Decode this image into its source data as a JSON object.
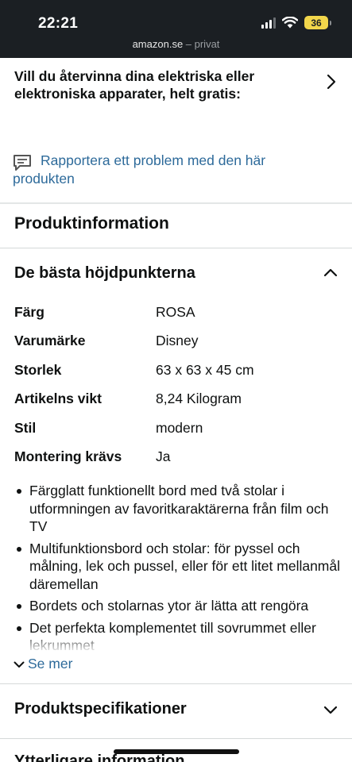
{
  "status_bar": {
    "time": "22:21",
    "battery": "36",
    "url_domain": "amazon.se",
    "url_suffix": " – privat"
  },
  "recycle": {
    "text": "Vill du återvinna dina elektriska eller elektroniska apparater, helt gratis:",
    "icon": "chevron-right-icon"
  },
  "report": {
    "text": "Rapportera ett problem med den här produkten",
    "icon": "feedback-icon"
  },
  "product_info": {
    "heading": "Produktinformation"
  },
  "highlights": {
    "title": "De bästa höjdpunkterna",
    "icon": "chevron-up-icon",
    "specs": [
      {
        "key": "Färg",
        "value": "ROSA"
      },
      {
        "key": "Varumärke",
        "value": "Disney"
      },
      {
        "key": "Storlek",
        "value": "63 x 63 x 45 cm"
      },
      {
        "key": "Artikelns vikt",
        "value": "8,24 Kilogram"
      },
      {
        "key": "Stil",
        "value": "modern"
      },
      {
        "key": "Montering krävs",
        "value": "Ja"
      }
    ],
    "bullets": [
      "Färgglatt funktionellt bord med två stolar i utformningen av favoritkaraktärerna från film och TV",
      "Multifunktionsbord och stolar: för pyssel och målning, lek och pussel, eller för ett litet mellanmål däremellan",
      "Bordets och stolarnas ytor är lätta att rengöra",
      "Det perfekta komplementet till sovrummet eller lekrummet"
    ],
    "see_more": "Se mer"
  },
  "specifications": {
    "title": "Produktspecifikationer",
    "icon": "chevron-down-icon"
  },
  "next_section": {
    "title": "Ytterligare information"
  },
  "colors": {
    "link": "#2d6a9a",
    "text": "#0f1111",
    "topbar": "#1b1f23",
    "battery": "#f2d64b"
  }
}
